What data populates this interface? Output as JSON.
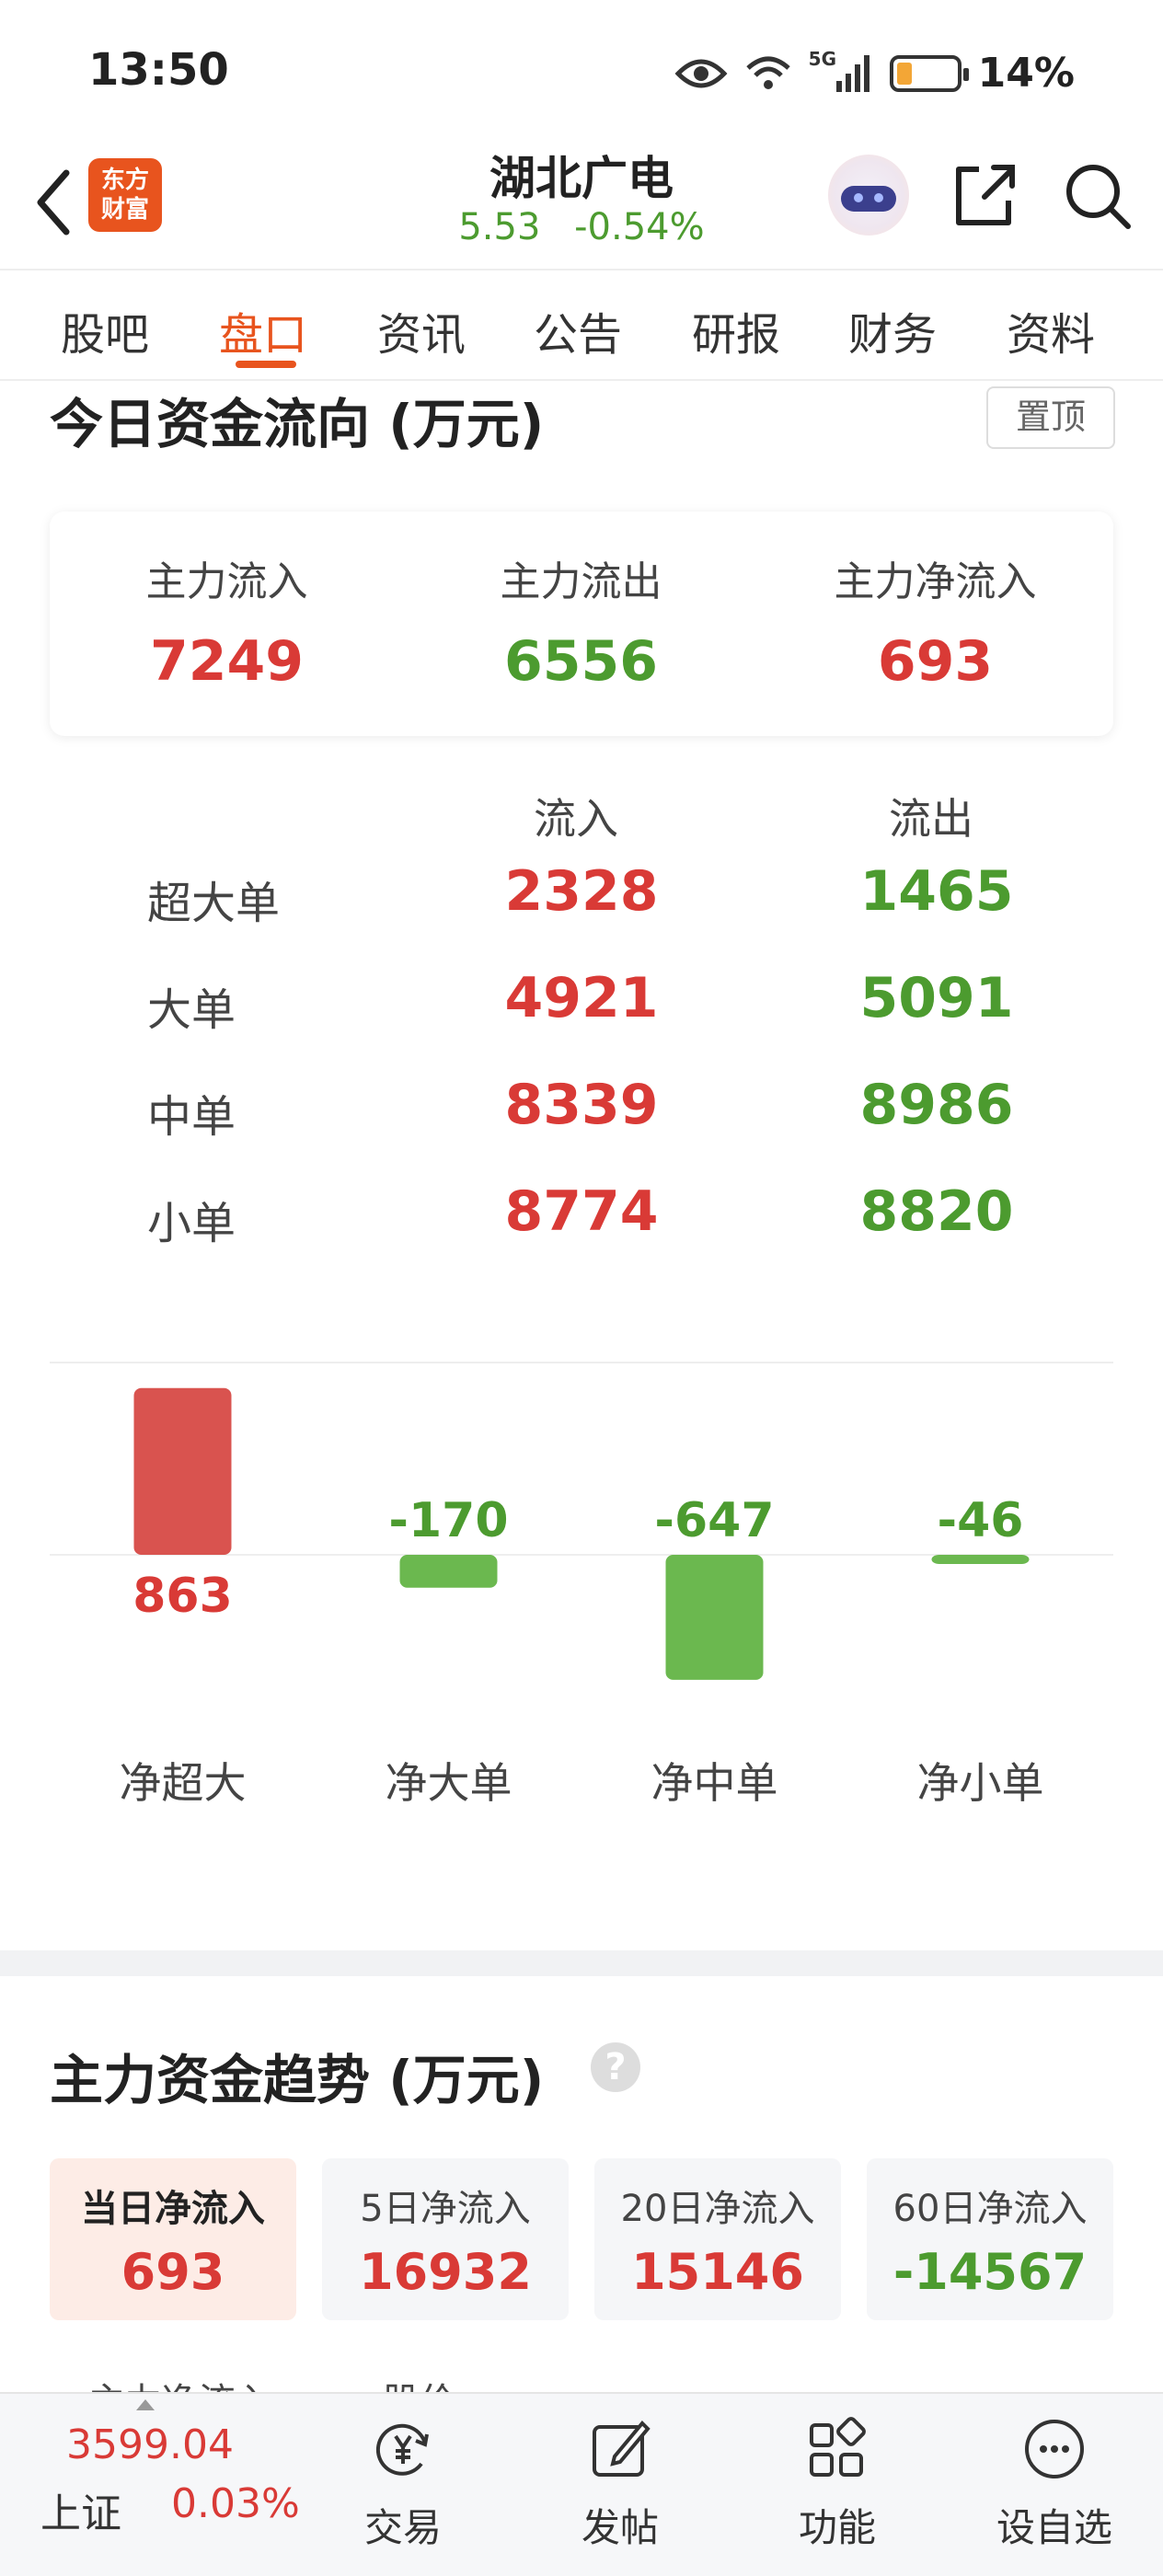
{
  "status": {
    "time": "13:50",
    "network": "5G",
    "battery": "14%"
  },
  "header": {
    "logo_text": "东方财富",
    "stock_name": "湖北广电",
    "price": "5.53",
    "change": "-0.54%"
  },
  "tabs": [
    {
      "label": "股吧"
    },
    {
      "label": "盘口"
    },
    {
      "label": "资讯"
    },
    {
      "label": "公告"
    },
    {
      "label": "研报"
    },
    {
      "label": "财务"
    },
    {
      "label": "资料"
    }
  ],
  "active_tab": "盘口",
  "fund_flow": {
    "title": "今日资金流向 (万元)",
    "pin_label": "置顶",
    "summary": [
      {
        "label": "主力流入",
        "value": "7249",
        "color": "#d93a36"
      },
      {
        "label": "主力流出",
        "value": "6556",
        "color": "#4c9b2f"
      },
      {
        "label": "主力净流入",
        "value": "693",
        "color": "#d93a36"
      }
    ],
    "columns": {
      "inflow": "流入",
      "outflow": "流出"
    },
    "rows": [
      {
        "label": "超大单",
        "inflow": "2328",
        "outflow": "1465"
      },
      {
        "label": "大单",
        "inflow": "4921",
        "outflow": "5091"
      },
      {
        "label": "中单",
        "inflow": "8339",
        "outflow": "8986"
      },
      {
        "label": "小单",
        "inflow": "8774",
        "outflow": "8820"
      }
    ]
  },
  "chart_data": {
    "type": "bar",
    "categories": [
      "净超大",
      "净大单",
      "净中单",
      "净小单"
    ],
    "values": [
      863,
      -170,
      -647,
      -46
    ],
    "colors": {
      "positive": "#d9534f",
      "negative": "#6bb84f"
    },
    "value_labels": [
      "863",
      "-170",
      "-647",
      "-46"
    ],
    "title": "",
    "xlabel": "",
    "ylabel": ""
  },
  "trend": {
    "title": "主力资金趋势 (万元)",
    "help_icon": "question-icon",
    "periods": [
      {
        "label": "当日净流入",
        "value": "693",
        "color": "#d93a36"
      },
      {
        "label": "5日净流入",
        "value": "16932",
        "color": "#d93a36"
      },
      {
        "label": "20日净流入",
        "value": "15146",
        "color": "#d93a36"
      },
      {
        "label": "60日净流入",
        "value": "-14567",
        "color": "#4c9b2f"
      }
    ],
    "cut_labels": [
      "主力净流入",
      "股价"
    ]
  },
  "bottom_bar": {
    "index_value": "3599.04",
    "index_name": "上证",
    "index_change": "0.03%",
    "nav": [
      {
        "label": "交易",
        "icon": "trade-yuan-icon"
      },
      {
        "label": "发帖",
        "icon": "edit-post-icon"
      },
      {
        "label": "功能",
        "icon": "apps-grid-icon"
      },
      {
        "label": "设自选",
        "icon": "more-dots-icon"
      }
    ]
  }
}
